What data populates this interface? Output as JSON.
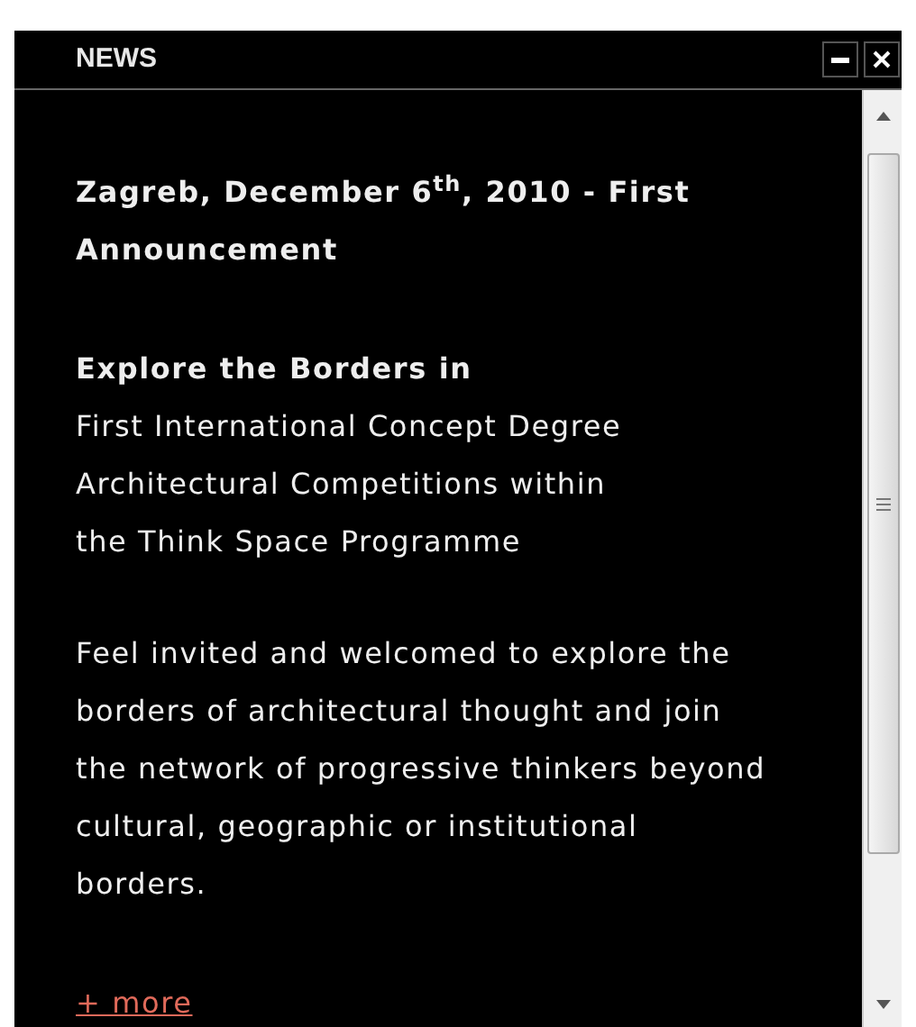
{
  "window": {
    "title": "NEWS",
    "controls": [
      {
        "kind": "minimize"
      },
      {
        "kind": "close"
      }
    ]
  },
  "article": {
    "heading": [
      "Zagreb, December 6$^{th}$, 2010 - First",
      "Announcement"
    ],
    "subtitle": "Explore the Borders in",
    "subtitle_lines": [
      "First International Concept Degree",
      "Architectural Competitions within",
      "the Think Space Programme"
    ],
    "body": [
      "Feel invited and welcomed to explore the",
      "borders of architectural thought and join",
      "the network of progressive thinkers beyond",
      "cultural, geographic or institutional",
      "borders."
    ],
    "more_link": "+ more"
  }
}
